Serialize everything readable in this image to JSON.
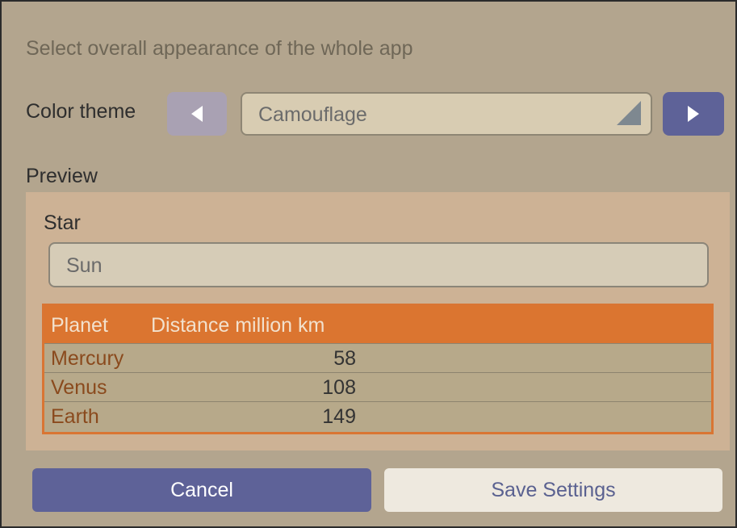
{
  "appearance": {
    "subtitle": "Select overall appearance of the whole app",
    "color_theme_label": "Color theme",
    "color_theme_value": "Camouflage",
    "prev_icon": "triangle-left-icon",
    "next_icon": "triangle-right-icon"
  },
  "preview": {
    "label": "Preview",
    "star_label": "Star",
    "star_value": "Sun",
    "table": {
      "columns": [
        "Planet",
        "Distance million km"
      ],
      "rows": [
        {
          "planet": "Mercury",
          "distance": "58"
        },
        {
          "planet": "Venus",
          "distance": "108"
        },
        {
          "planet": "Earth",
          "distance": "149"
        }
      ]
    }
  },
  "footer": {
    "cancel_label": "Cancel",
    "save_label": "Save Settings"
  },
  "colors": {
    "background": "#b3a58e",
    "accent": "#5e6298",
    "table_header": "#db7530",
    "preview_panel": "#cdb295"
  }
}
